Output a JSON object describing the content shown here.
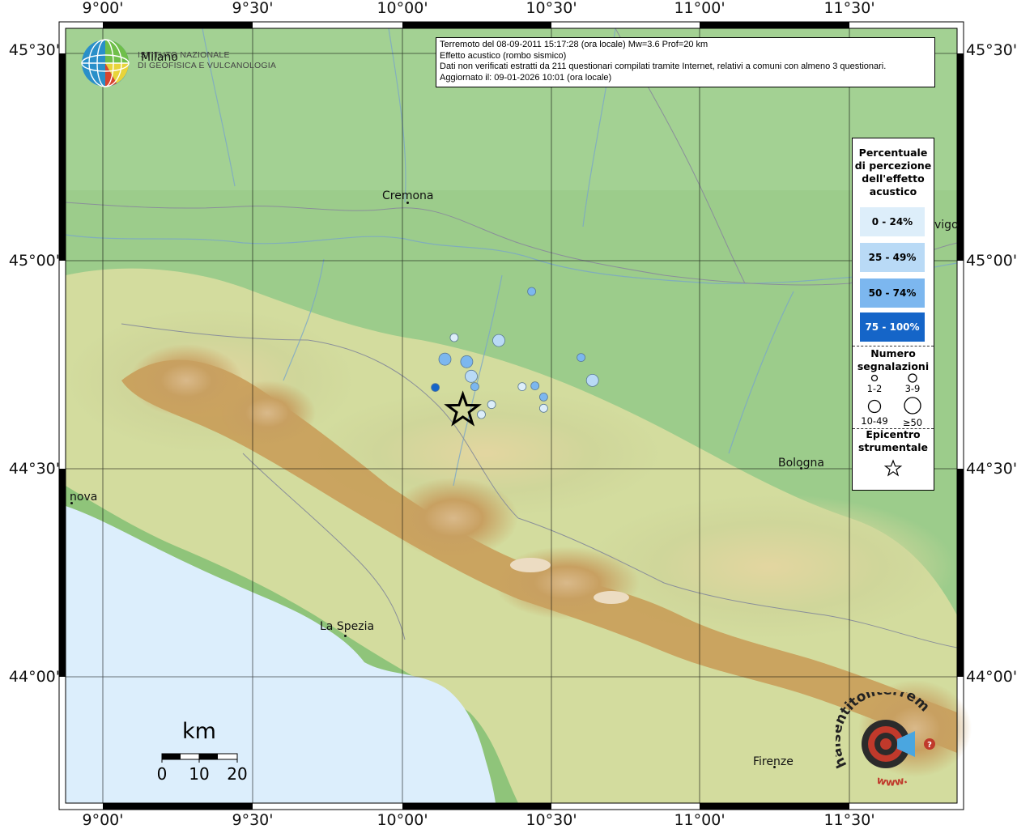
{
  "coordinates": {
    "longitudes": [
      "9°00'",
      "9°30'",
      "10°00'",
      "10°30'",
      "11°00'",
      "11°30'"
    ],
    "latitudes": [
      "45°30'",
      "45°00'",
      "44°30'",
      "44°00'"
    ]
  },
  "info_box": {
    "line1": "Terremoto del 08-09-2011 15:17:28 (ora locale) Mw=3.6 Prof=20 km",
    "line2": "Effetto acustico (rombo sismico)",
    "line3": "Dati non verificati estratti da 211 questionari compilati tramite Internet, relativi a comuni con almeno 3 questionari.",
    "line4": "Aggiornato il: 09-01-2026 10:01 (ora locale)"
  },
  "institute": {
    "line1": "ISTITUTO NAZIONALE",
    "line2": "DI GEOFISICA E VULCANOLOGIA"
  },
  "cities": {
    "milano": "Milano",
    "cremona": "Cremona",
    "bologna": "Bologna",
    "genova": "nova",
    "la_spezia": "La Spezia",
    "firenze": "Firenze",
    "rovigo": "vigo"
  },
  "legend": {
    "perc_title": [
      "Percentuale",
      "di percezione",
      "dell'effetto",
      "acustico"
    ],
    "classes": [
      {
        "label": "0 - 24%",
        "color": "#ddeefa",
        "text_color": "#000000"
      },
      {
        "label": "25 - 49%",
        "color": "#b9daf6",
        "text_color": "#000000"
      },
      {
        "label": "50 - 74%",
        "color": "#7cb7ef",
        "text_color": "#000000"
      },
      {
        "label": "75 - 100%",
        "color": "#1565c8",
        "text_color": "#ffffff"
      }
    ],
    "count_title": [
      "Numero",
      "segnalazioni"
    ],
    "count_labels": [
      "1-2",
      "3-9",
      "10-49",
      "≥50"
    ],
    "epicenter_title": [
      "Epicentro",
      "strumentale"
    ]
  },
  "observations": [
    {
      "lon": 10.433,
      "lat": 44.926,
      "class": 2,
      "size": 1
    },
    {
      "lon": 10.174,
      "lat": 44.815,
      "class": 0,
      "size": 1
    },
    {
      "lon": 10.323,
      "lat": 44.808,
      "class": 1,
      "size": 2
    },
    {
      "lon": 10.143,
      "lat": 44.763,
      "class": 2,
      "size": 2
    },
    {
      "lon": 10.216,
      "lat": 44.757,
      "class": 2,
      "size": 2
    },
    {
      "lon": 10.598,
      "lat": 44.767,
      "class": 2,
      "size": 1
    },
    {
      "lon": 10.231,
      "lat": 44.722,
      "class": 1,
      "size": 2
    },
    {
      "lon": 10.636,
      "lat": 44.712,
      "class": 1,
      "size": 2
    },
    {
      "lon": 10.111,
      "lat": 44.695,
      "class": 3,
      "size": 1
    },
    {
      "lon": 10.243,
      "lat": 44.697,
      "class": 2,
      "size": 1
    },
    {
      "lon": 10.401,
      "lat": 44.697,
      "class": 0,
      "size": 1
    },
    {
      "lon": 10.444,
      "lat": 44.699,
      "class": 2,
      "size": 1
    },
    {
      "lon": 10.473,
      "lat": 44.672,
      "class": 2,
      "size": 1
    },
    {
      "lon": 10.299,
      "lat": 44.654,
      "class": 0,
      "size": 1
    },
    {
      "lon": 10.473,
      "lat": 44.645,
      "class": 0,
      "size": 1
    },
    {
      "lon": 10.265,
      "lat": 44.63,
      "class": 0,
      "size": 1
    }
  ],
  "epicenter": {
    "lon": 10.203,
    "lat": 44.64
  },
  "scale_bar": {
    "unit": "km",
    "ticks": [
      "0",
      "10",
      "20"
    ]
  },
  "site_logo": {
    "text": "haisentitoilterremoto.it",
    "url_text": "www."
  },
  "colors": {
    "sea": "#dceefc",
    "plain": "#9ccc8b",
    "mountain": "#c89a55",
    "peak": "#ecdcc2",
    "frame": "#000000"
  }
}
